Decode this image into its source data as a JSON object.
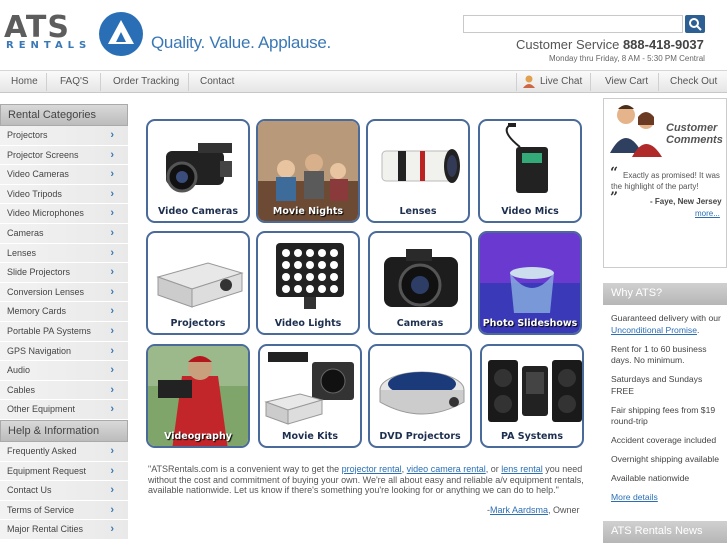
{
  "brand": {
    "logo_word": "ATS",
    "logo_sub": "RENTALS",
    "tagline": "Quality. Value. Applause.",
    "accent": "#3a78b5",
    "nav_bg": "#eeeeee"
  },
  "search": {
    "placeholder": "",
    "button_icon": "search-icon"
  },
  "contact": {
    "label": "Customer Service",
    "phone": "888-418-9037",
    "hours": "Monday thru Friday, 8 AM - 5:30 PM Central"
  },
  "nav": {
    "left": [
      "Home",
      "FAQ'S",
      "Order Tracking",
      "Contact"
    ],
    "right": [
      "Live Chat",
      "View Cart",
      "Check Out"
    ]
  },
  "sidebar": {
    "categories_title": "Rental Categories",
    "categories": [
      "Projectors",
      "Projector Screens",
      "Video Cameras",
      "Video Tripods",
      "Video Microphones",
      "Cameras",
      "Lenses",
      "Slide Projectors",
      "Conversion Lenses",
      "Memory Cards",
      "Portable PA Systems",
      "GPS Navigation",
      "Audio",
      "Cables",
      "Other Equipment"
    ],
    "help_title": "Help & Information",
    "help": [
      "Frequently Asked",
      "Equipment Request",
      "Contact Us",
      "Terms of Service",
      "Major Rental Cities"
    ]
  },
  "tiles": [
    "Video Cameras",
    "Movie Nights",
    "Lenses",
    "Video Mics",
    "Projectors",
    "Video Lights",
    "Cameras",
    "Photo Slideshows",
    "Videography",
    "Movie Kits",
    "DVD Projectors",
    "PA Systems"
  ],
  "intro": {
    "p1": "\"ATSRentals.com is a convenient way to get the ",
    "link1": "projector rental",
    "p2": ", ",
    "link2": "video camera rental",
    "p3": ", or ",
    "link3": "lens rental",
    "p4": " you need without the cost and commitment of buying your own. We're all about easy and reliable a/v equipment rentals, available nationwide. Let us know if there's something you're looking for or anything we can do to help.\"",
    "owner_prefix": "-",
    "owner_name": "Mark Aardsma",
    "owner_suffix": ", Owner"
  },
  "comments": {
    "title_1": "Customer",
    "title_2": "Comments",
    "quote": "Exactly as promised! It was the highlight of the party!",
    "from": "- Faye, New Jersey",
    "more": "more..."
  },
  "why": {
    "title": "Why ATS?",
    "item1_a": "Guaranteed delivery with our ",
    "item1_link": "Unconditional Promise",
    "item1_b": ".",
    "items": [
      "Rent for 1 to 60 business days. No minimum.",
      "Saturdays and Sundays FREE",
      "Fair shipping fees from $19 round-trip",
      "Accident coverage included",
      "Overnight shipping available",
      "Available nationwide"
    ],
    "more": "More details"
  },
  "news": {
    "title": "ATS Rentals News"
  }
}
